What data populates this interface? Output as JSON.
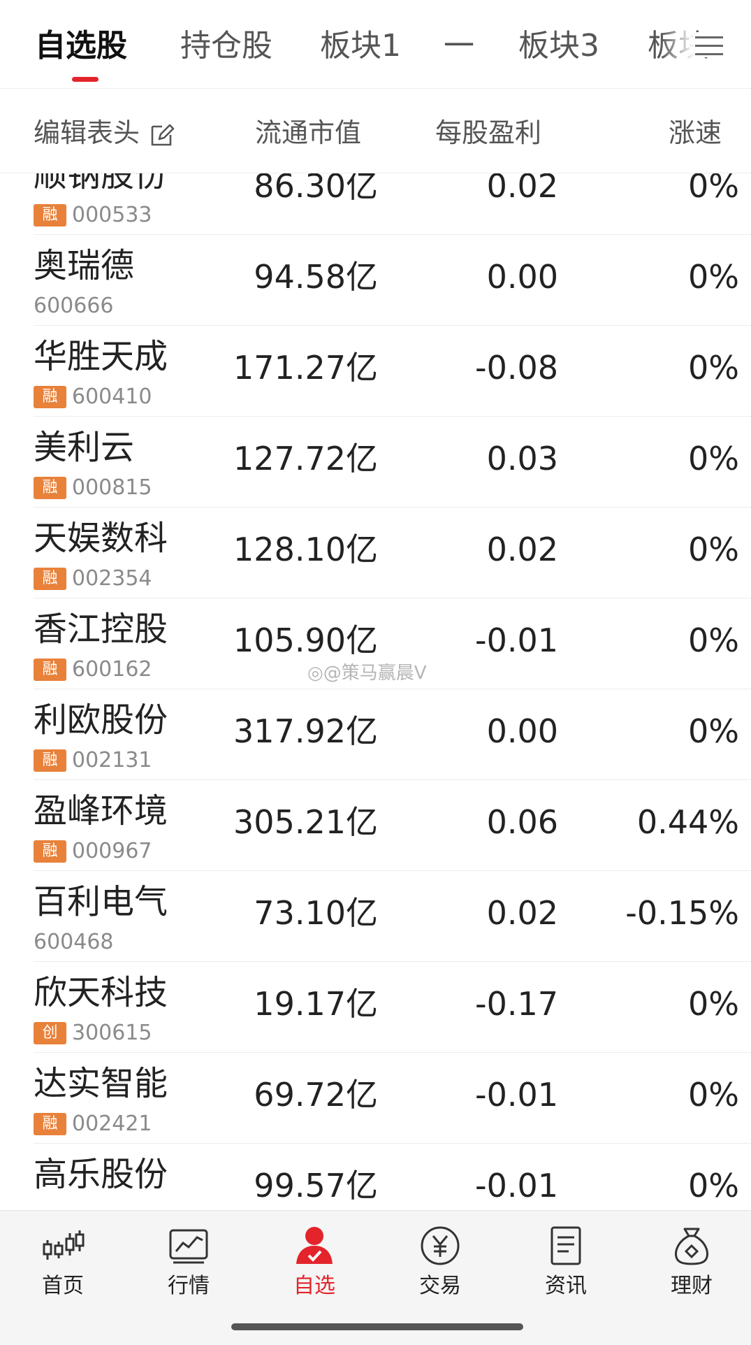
{
  "tabs": [
    {
      "label": "自选股",
      "active": true
    },
    {
      "label": "持仓股",
      "active": false
    },
    {
      "label": "板块1",
      "active": false
    },
    {
      "label": "一",
      "active": false
    },
    {
      "label": "板块3",
      "active": false
    },
    {
      "label": "板块",
      "active": false
    }
  ],
  "header": {
    "edit_label": "编辑表头",
    "col_mktcap": "流通市值",
    "col_eps": "每股盈利",
    "col_speed": "涨速"
  },
  "rows": [
    {
      "name": "顺钠股份",
      "badge": "融",
      "code": "000533",
      "mktcap": "86.30亿",
      "eps": "0.02",
      "speed": "0%"
    },
    {
      "name": "奥瑞德",
      "badge": "",
      "code": "600666",
      "mktcap": "94.58亿",
      "eps": "0.00",
      "speed": "0%"
    },
    {
      "name": "华胜天成",
      "badge": "融",
      "code": "600410",
      "mktcap": "171.27亿",
      "eps": "-0.08",
      "speed": "0%"
    },
    {
      "name": "美利云",
      "badge": "融",
      "code": "000815",
      "mktcap": "127.72亿",
      "eps": "0.03",
      "speed": "0%"
    },
    {
      "name": "天娱数科",
      "badge": "融",
      "code": "002354",
      "mktcap": "128.10亿",
      "eps": "0.02",
      "speed": "0%"
    },
    {
      "name": "香江控股",
      "badge": "融",
      "code": "600162",
      "mktcap": "105.90亿",
      "eps": "-0.01",
      "speed": "0%"
    },
    {
      "name": "利欧股份",
      "badge": "融",
      "code": "002131",
      "mktcap": "317.92亿",
      "eps": "0.00",
      "speed": "0%"
    },
    {
      "name": "盈峰环境",
      "badge": "融",
      "code": "000967",
      "mktcap": "305.21亿",
      "eps": "0.06",
      "speed": "0.44%"
    },
    {
      "name": "百利电气",
      "badge": "",
      "code": "600468",
      "mktcap": "73.10亿",
      "eps": "0.02",
      "speed": "-0.15%"
    },
    {
      "name": "欣天科技",
      "badge": "创",
      "code": "300615",
      "mktcap": "19.17亿",
      "eps": "-0.17",
      "speed": "0%"
    },
    {
      "name": "达实智能",
      "badge": "融",
      "code": "002421",
      "mktcap": "69.72亿",
      "eps": "-0.01",
      "speed": "0%"
    },
    {
      "name": "高乐股份",
      "badge": "",
      "code": "",
      "mktcap": "99.57亿",
      "eps": "-0.01",
      "speed": "0%"
    }
  ],
  "watermark": "@策马赢晨V",
  "nav": [
    {
      "label": "首页",
      "icon": "candlestick-icon",
      "active": false
    },
    {
      "label": "行情",
      "icon": "market-chart-icon",
      "active": false
    },
    {
      "label": "自选",
      "icon": "user-favorite-icon",
      "active": true
    },
    {
      "label": "交易",
      "icon": "yen-coin-icon",
      "active": false
    },
    {
      "label": "资讯",
      "icon": "document-icon",
      "active": false
    },
    {
      "label": "理财",
      "icon": "money-bag-icon",
      "active": false
    }
  ],
  "colors": {
    "accent": "#e3242b",
    "up": "#d8242c",
    "down": "#1f9b34",
    "badge": "#e8813a"
  }
}
